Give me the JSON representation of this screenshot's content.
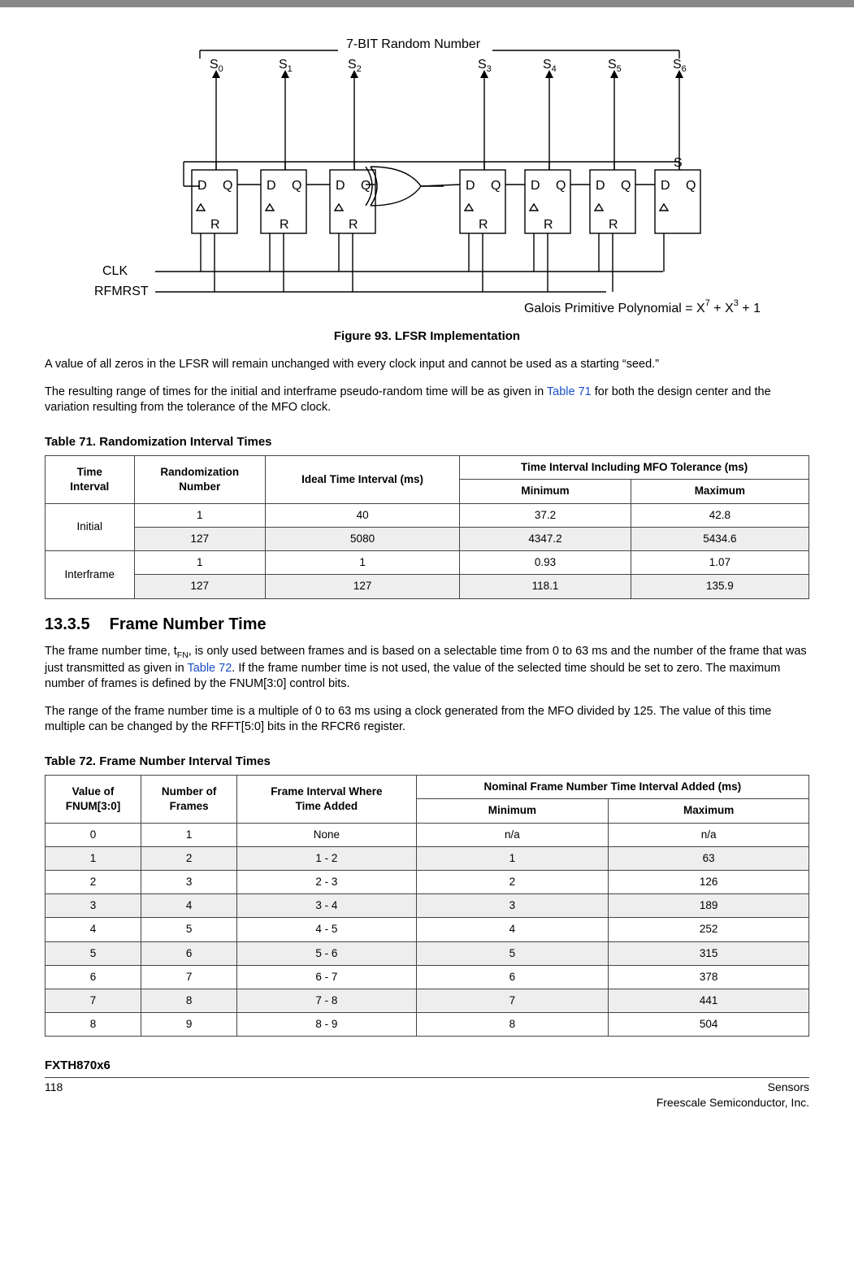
{
  "figure": {
    "bracket_label": "7-BIT Random Number",
    "s_labels": [
      "S",
      "S",
      "S",
      "S",
      "S",
      "S",
      "S"
    ],
    "s_subs": [
      "0",
      "1",
      "2",
      "3",
      "4",
      "5",
      "6"
    ],
    "ff": {
      "D": "D",
      "Q": "Q",
      "R": "R",
      "S": "S"
    },
    "clk_label": "CLK",
    "rst_label": "RFMRST",
    "poly_text": "Galois Primitive Polynomial = X",
    "poly_sup1": "7",
    "poly_mid": " + X",
    "poly_sup2": "3",
    "poly_end": " + 1",
    "caption": "Figure 93. LFSR Implementation"
  },
  "para1": "A value of all zeros in the LFSR will remain unchanged with every clock input and cannot be used as a starting “seed.”",
  "para2a": "The resulting range of times for the initial and interframe pseudo-random time will be as given in ",
  "para2link": "Table 71",
  "para2b": " for both the design center and the variation resulting from the tolerance of the MFO clock.",
  "table71": {
    "title": "Table 71. Randomization Interval Times",
    "headers": {
      "c1": "Time\nInterval",
      "c2": "Randomization\nNumber",
      "c3": "Ideal Time Interval (ms)",
      "c4span": "Time Interval Including MFO Tolerance (ms)",
      "c4a": "Minimum",
      "c4b": "Maximum"
    },
    "rows": [
      {
        "interval": "Initial",
        "num": "1",
        "ideal": "40",
        "min": "37.2",
        "max": "42.8"
      },
      {
        "num": "127",
        "ideal": "5080",
        "min": "4347.2",
        "max": "5434.6"
      },
      {
        "interval": "Interframe",
        "num": "1",
        "ideal": "1",
        "min": "0.93",
        "max": "1.07"
      },
      {
        "num": "127",
        "ideal": "127",
        "min": "118.1",
        "max": "135.9"
      }
    ]
  },
  "section": {
    "num": "13.3.5",
    "title": "Frame Number Time"
  },
  "para3a": "The frame number time, t",
  "para3sub": "FN",
  "para3b": ", is only used between frames and is based on a selectable time from 0 to 63 ms and the number of the frame that was just transmitted as given in ",
  "para3link": "Table 72",
  "para3c": ". If the frame number time is not used, the value of the selected time should be set to zero. The maximum number of frames is defined by the FNUM[3:0] control bits.",
  "para4": "The range of the frame number time is a multiple of 0 to 63 ms using a clock generated from the MFO divided by 125. The value of this time multiple can be changed by the RFFT[5:0] bits in the RFCR6 register.",
  "table72": {
    "title": "Table 72. Frame Number Interval Times",
    "headers": {
      "c1": "Value of\nFNUM[3:0]",
      "c2": "Number of\nFrames",
      "c3": "Frame Interval Where\nTime Added",
      "c4span": "Nominal Frame Number Time Interval Added (ms)",
      "c4a": "Minimum",
      "c4b": "Maximum"
    },
    "rows": [
      [
        "0",
        "1",
        "None",
        "n/a",
        "n/a"
      ],
      [
        "1",
        "2",
        "1 - 2",
        "1",
        "63"
      ],
      [
        "2",
        "3",
        "2 - 3",
        "2",
        "126"
      ],
      [
        "3",
        "4",
        "3 - 4",
        "3",
        "189"
      ],
      [
        "4",
        "5",
        "4 - 5",
        "4",
        "252"
      ],
      [
        "5",
        "6",
        "5 - 6",
        "5",
        "315"
      ],
      [
        "6",
        "7",
        "6 - 7",
        "6",
        "378"
      ],
      [
        "7",
        "8",
        "7 - 8",
        "7",
        "441"
      ],
      [
        "8",
        "9",
        "8 - 9",
        "8",
        "504"
      ]
    ]
  },
  "footer": {
    "product": "FXTH870x6",
    "page": "118",
    "line1": "Sensors",
    "line2": "Freescale Semiconductor, Inc."
  },
  "chart_data": [
    {
      "type": "table",
      "title": "Table 71. Randomization Interval Times",
      "columns": [
        "Time Interval",
        "Randomization Number",
        "Ideal Time Interval (ms)",
        "Min Incl. MFO Tol (ms)",
        "Max Incl. MFO Tol (ms)"
      ],
      "rows": [
        [
          "Initial",
          1,
          40,
          37.2,
          42.8
        ],
        [
          "Initial",
          127,
          5080,
          4347.2,
          5434.6
        ],
        [
          "Interframe",
          1,
          1,
          0.93,
          1.07
        ],
        [
          "Interframe",
          127,
          127,
          118.1,
          135.9
        ]
      ]
    },
    {
      "type": "table",
      "title": "Table 72. Frame Number Interval Times",
      "columns": [
        "FNUM[3:0]",
        "Number of Frames",
        "Frame Interval Where Time Added",
        "Nominal Min (ms)",
        "Nominal Max (ms)"
      ],
      "rows": [
        [
          0,
          1,
          "None",
          "n/a",
          "n/a"
        ],
        [
          1,
          2,
          "1 - 2",
          1,
          63
        ],
        [
          2,
          3,
          "2 - 3",
          2,
          126
        ],
        [
          3,
          4,
          "3 - 4",
          3,
          189
        ],
        [
          4,
          5,
          "4 - 5",
          4,
          252
        ],
        [
          5,
          6,
          "5 - 6",
          5,
          315
        ],
        [
          6,
          7,
          "6 - 7",
          6,
          378
        ],
        [
          7,
          8,
          "7 - 8",
          7,
          441
        ],
        [
          8,
          9,
          "8 - 9",
          8,
          504
        ]
      ]
    }
  ]
}
